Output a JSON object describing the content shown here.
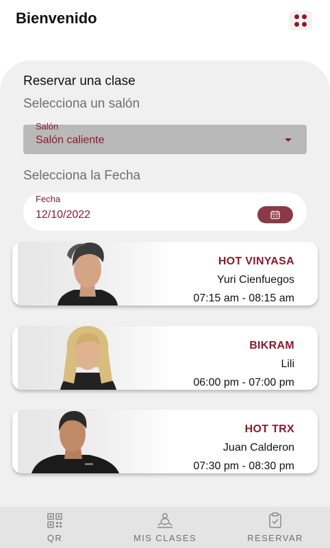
{
  "header": {
    "title": "Bienvenido",
    "menu_icon": "grid-dots-icon"
  },
  "colors": {
    "accent": "#8b1a2a",
    "panel": "#f0f0f0",
    "nav": "#e4e4e4"
  },
  "booking": {
    "title": "Reservar una clase",
    "room_prompt": "Selecciona un salón",
    "room_select": {
      "label": "Salón",
      "value": "Salón caliente"
    },
    "date_prompt": "Selecciona la Fecha",
    "date_field": {
      "label": "Fecha",
      "value": "12/10/2022",
      "icon": "calendar-icon"
    }
  },
  "classes": [
    {
      "name": "HOT VINYASA",
      "instructor": "Yuri Cienfuegos",
      "time": "07:15 am - 08:15 am"
    },
    {
      "name": "BIKRAM",
      "instructor": "Lili",
      "time": "06:00 pm - 07:00 pm"
    },
    {
      "name": "HOT TRX",
      "instructor": "Juan Calderon",
      "time": "07:30 pm - 08:30 pm"
    }
  ],
  "nav": [
    {
      "label": "QR",
      "icon": "qr-code-icon"
    },
    {
      "label": "MIS CLASES",
      "icon": "meditation-icon"
    },
    {
      "label": "RESERVAR",
      "icon": "clipboard-check-icon"
    }
  ]
}
